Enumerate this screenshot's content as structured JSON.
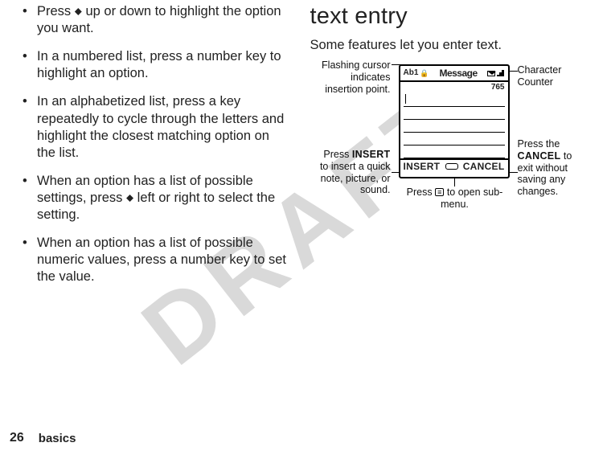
{
  "watermark": "DRAFT",
  "page_number": "26",
  "section_footer": "basics",
  "left_column": {
    "bullets": [
      {
        "pre": "Press ",
        "key": "⬥",
        "post": " up or down to highlight the option you want."
      },
      {
        "text": "In a numbered list, press a number key to highlight an option."
      },
      {
        "text": "In an alphabetized list, press a key repeatedly to cycle through the letters and highlight the closest matching option on the list."
      },
      {
        "pre": "When an option has a list of possible settings, press ",
        "key": "⬥",
        "post": " left or right to select the setting."
      },
      {
        "text": "When an option has a list of possible numeric values, press a number key to set the value."
      }
    ]
  },
  "right_column": {
    "heading": "text entry",
    "intro": "Some features let you enter text.",
    "diagram": {
      "callout_cursor": "Flashing cursor indicates insertion point.",
      "callout_insert_pre": "Press ",
      "callout_insert_key": "INSERT",
      "callout_insert_post": " to insert a quick note, picture, or sound.",
      "callout_counter": "Character Counter",
      "callout_cancel_pre": "Press the ",
      "callout_cancel_key": "CANCEL",
      "callout_cancel_post": " to exit without saving any changes.",
      "callout_menu_pre": "Press ",
      "callout_menu_key": "≡",
      "callout_menu_post": " to open sub-menu.",
      "phone": {
        "mode_indicator": "Ab1",
        "title": "Message",
        "counter": "765",
        "softkey_left": "INSERT",
        "softkey_right": "CANCEL"
      }
    }
  }
}
